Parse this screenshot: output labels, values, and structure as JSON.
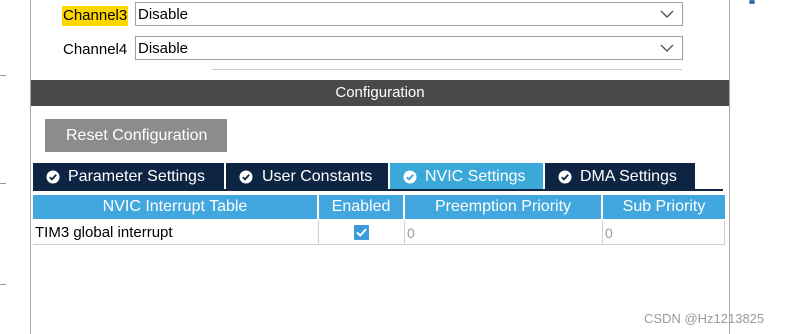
{
  "channels": [
    {
      "label": "Channel3",
      "value": "Disable",
      "highlighted": true
    },
    {
      "label": "Channel4",
      "value": "Disable",
      "highlighted": false
    }
  ],
  "configuration": {
    "header": "Configuration",
    "reset_label": "Reset Configuration"
  },
  "tabs": [
    {
      "label": "Parameter Settings",
      "icon": "check-circle-icon",
      "active": false
    },
    {
      "label": "User Constants",
      "icon": "check-circle-icon",
      "active": false
    },
    {
      "label": "NVIC Settings",
      "icon": "check-circle-icon",
      "active": true
    },
    {
      "label": "DMA Settings",
      "icon": "check-circle-icon",
      "active": false
    }
  ],
  "nvic_table": {
    "headers": [
      "NVIC Interrupt Table",
      "Enabled",
      "Preemption Priority",
      "Sub Priority"
    ],
    "rows": [
      {
        "interrupt": "TIM3 global interrupt",
        "enabled": true,
        "preemption": "0",
        "sub": "0"
      }
    ]
  },
  "colors": {
    "header_bg": "#4a4a4a",
    "tab_bg": "#0d2543",
    "tab_active_bg": "#3aa8d8",
    "table_header_bg": "#41a7de",
    "highlight": "#ffd700"
  },
  "watermark": "CSDN @Hz1213825"
}
